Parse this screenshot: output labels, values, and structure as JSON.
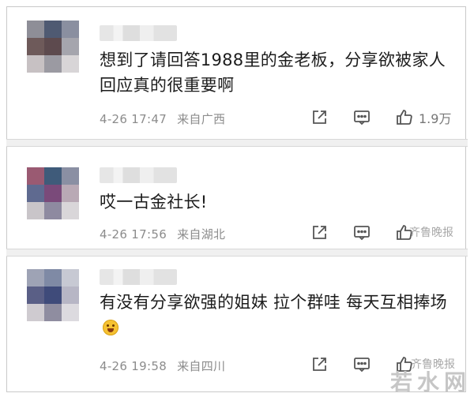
{
  "comments": [
    {
      "text": "想到了请回答1988里的金老板，分享欲被家人回应真的很重要啊",
      "time": "4-26 17:47",
      "location": "来自广西",
      "likes": "1.9万",
      "avatar_colors": [
        "#8e8e97",
        "#4f5a72",
        "#8a8fa0",
        "#6e5a5a",
        "#5d4a4e",
        "#a5a5ad",
        "#c7c1c3",
        "#9b9aa2",
        "#d8d5d7"
      ]
    },
    {
      "text": "哎一古金社长!",
      "time": "4-26 17:56",
      "location": "来自湖北",
      "likes": "",
      "avatar_colors": [
        "#9a5a72",
        "#3f5b7a",
        "#8a8fa3",
        "#5f6a90",
        "#7a4a7a",
        "#b9a9b5",
        "#c9c5c9",
        "#8e8aa0",
        "#d9d6d9"
      ]
    },
    {
      "text": "有没有分享欲强的姐妹 拉个群哇  每天互相捧场",
      "time": "4-26 19:58",
      "location": "来自四川",
      "likes": "",
      "avatar_colors": [
        "#9ea3b5",
        "#7f8aa5",
        "#c7c9d3",
        "#5a5f86",
        "#3f4b7a",
        "#b7b6c5",
        "#cfcbd0",
        "#8f8da0",
        "#dcdadf"
      ]
    }
  ],
  "watermarks": {
    "small": "齐鲁晚报",
    "big": "若水网"
  }
}
